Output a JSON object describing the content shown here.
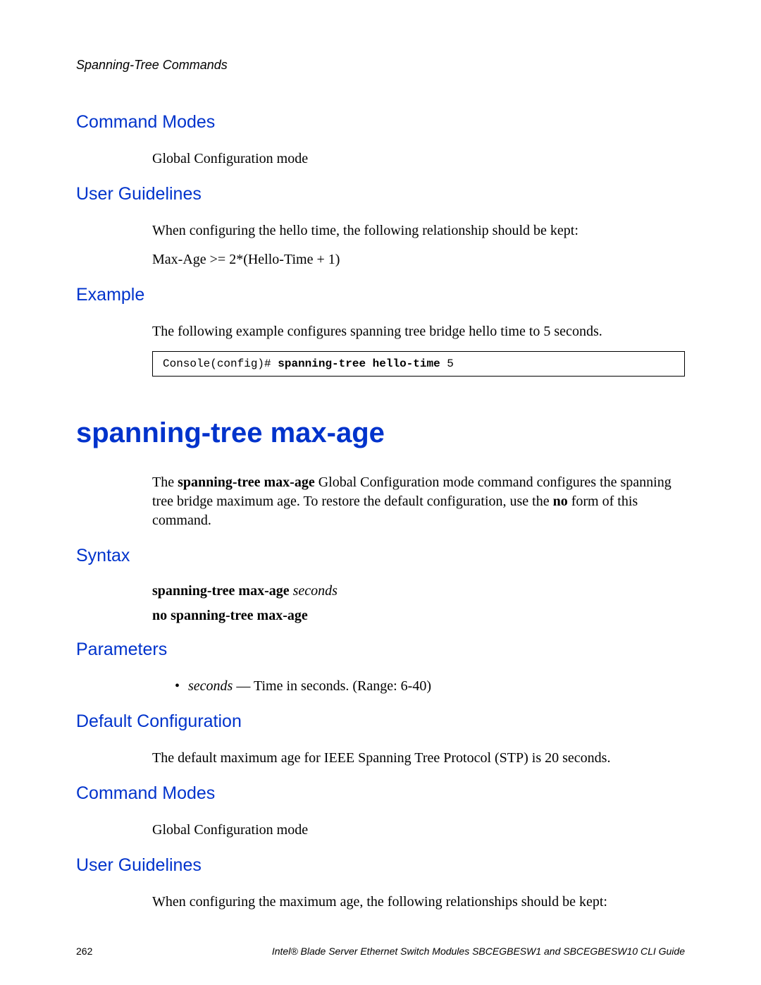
{
  "running_header": "Spanning-Tree Commands",
  "section_1": {
    "command_modes_heading": "Command Modes",
    "command_modes_text": "Global Configuration mode",
    "user_guidelines_heading": "User Guidelines",
    "user_guidelines_text": "When configuring the hello time, the following relationship should be kept:",
    "user_guidelines_formula": "Max-Age >= 2*(Hello-Time + 1)",
    "example_heading": "Example",
    "example_text": "The following example configures spanning tree bridge hello time to 5 seconds.",
    "example_code_prompt": "Console(config)# ",
    "example_code_bold": "spanning-tree hello-time",
    "example_code_arg": " 5"
  },
  "command_title": "spanning-tree max-age",
  "intro": {
    "part1": "The ",
    "bold1": "spanning-tree max-age",
    "part2": " Global Configuration mode command configures the spanning tree bridge maximum age. To restore the default configuration, use the ",
    "bold2": "no",
    "part3": " form of this command."
  },
  "syntax": {
    "heading": "Syntax",
    "line1_bold": "spanning-tree max-age ",
    "line1_italic": "seconds",
    "line2": "no spanning-tree max-age"
  },
  "parameters": {
    "heading": "Parameters",
    "item_italic": "seconds",
    "item_text": " — Time in seconds. (Range: 6-40)"
  },
  "default_config": {
    "heading": "Default Configuration",
    "text": "The default maximum age for IEEE Spanning Tree Protocol (STP) is 20 seconds."
  },
  "section_2": {
    "command_modes_heading": "Command Modes",
    "command_modes_text": "Global Configuration mode",
    "user_guidelines_heading": "User Guidelines",
    "user_guidelines_text": "When configuring the maximum age, the following relationships should be kept:"
  },
  "footer": {
    "page": "262",
    "title": "Intel® Blade Server Ethernet Switch Modules SBCEGBESW1 and SBCEGBESW10 CLI Guide"
  }
}
